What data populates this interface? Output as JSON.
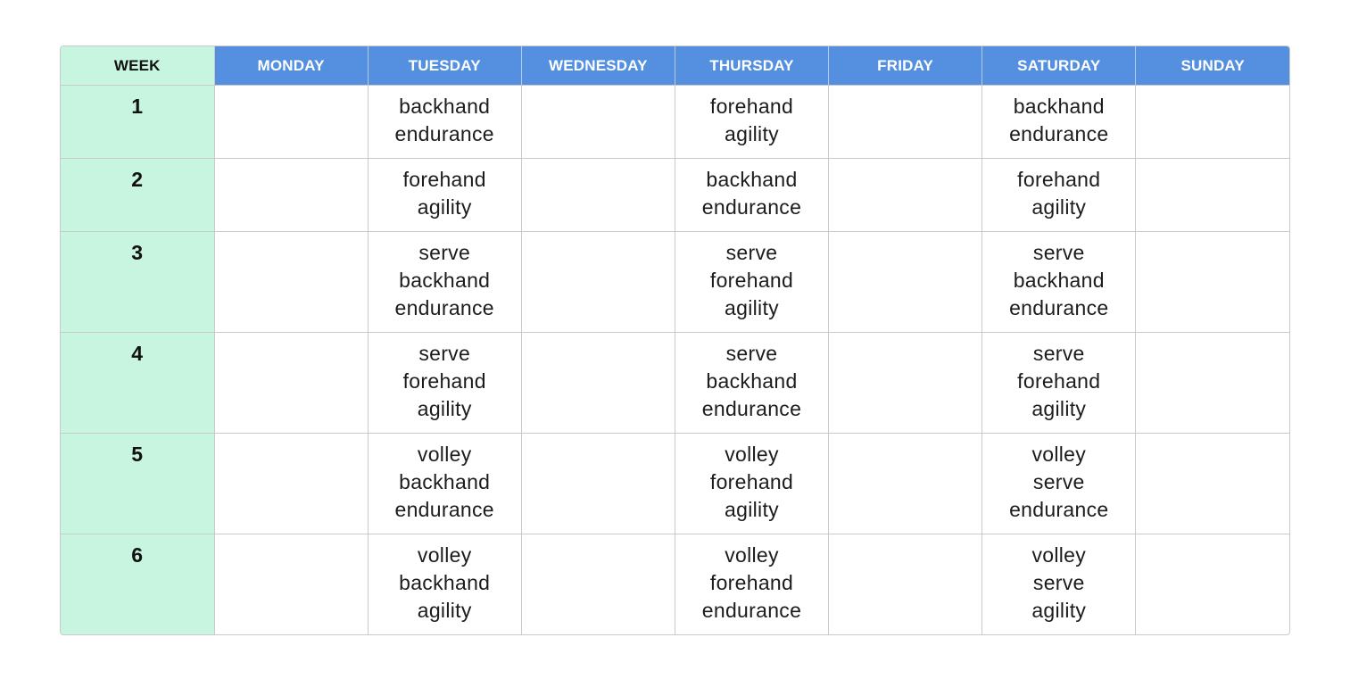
{
  "header": {
    "week": "WEEK",
    "days": [
      "MONDAY",
      "TUESDAY",
      "WEDNESDAY",
      "THURSDAY",
      "FRIDAY",
      "SATURDAY",
      "SUNDAY"
    ]
  },
  "weeks": [
    {
      "week": "1",
      "tuesday": [
        "backhand",
        "endurance"
      ],
      "thursday": [
        "forehand",
        "agility"
      ],
      "saturday": [
        "backhand",
        "endurance"
      ]
    },
    {
      "week": "2",
      "tuesday": [
        "forehand",
        "agility"
      ],
      "thursday": [
        "backhand",
        "endurance"
      ],
      "saturday": [
        "forehand",
        "agility"
      ]
    },
    {
      "week": "3",
      "tuesday": [
        "serve",
        "backhand",
        "endurance"
      ],
      "thursday": [
        "serve",
        "forehand",
        "agility"
      ],
      "saturday": [
        "serve",
        "backhand",
        "endurance"
      ]
    },
    {
      "week": "4",
      "tuesday": [
        "serve",
        "forehand",
        "agility"
      ],
      "thursday": [
        "serve",
        "backhand",
        "endurance"
      ],
      "saturday": [
        "serve",
        "forehand",
        "agility"
      ]
    },
    {
      "week": "5",
      "tuesday": [
        "volley",
        "backhand",
        "endurance"
      ],
      "thursday": [
        "volley",
        "forehand",
        "agility"
      ],
      "saturday": [
        "volley",
        "serve",
        "endurance"
      ]
    },
    {
      "week": "6",
      "tuesday": [
        "volley",
        "backhand",
        "agility"
      ],
      "thursday": [
        "volley",
        "forehand",
        "endurance"
      ],
      "saturday": [
        "volley",
        "serve",
        "agility"
      ]
    }
  ]
}
